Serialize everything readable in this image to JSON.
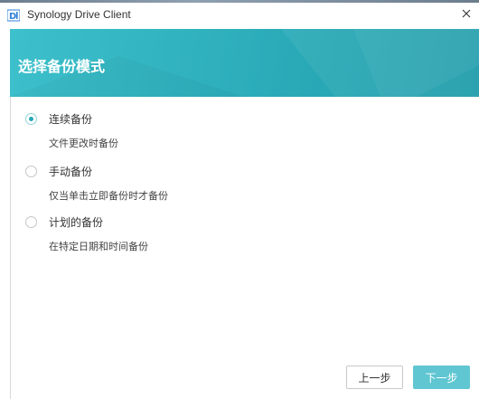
{
  "window": {
    "title": "Synology Drive Client",
    "close_icon": "close-icon",
    "logo_icon": "synology-drive-logo-icon"
  },
  "header": {
    "title": "选择备份模式",
    "accent_color": "#2aaab7"
  },
  "options": [
    {
      "label": "连续备份",
      "description": "文件更改时备份",
      "selected": true
    },
    {
      "label": "手动备份",
      "description": "仅当单击立即备份时才备份",
      "selected": false
    },
    {
      "label": "计划的备份",
      "description": "在特定日期和时间备份",
      "selected": false
    }
  ],
  "footer": {
    "back_label": "上一步",
    "next_label": "下一步"
  }
}
